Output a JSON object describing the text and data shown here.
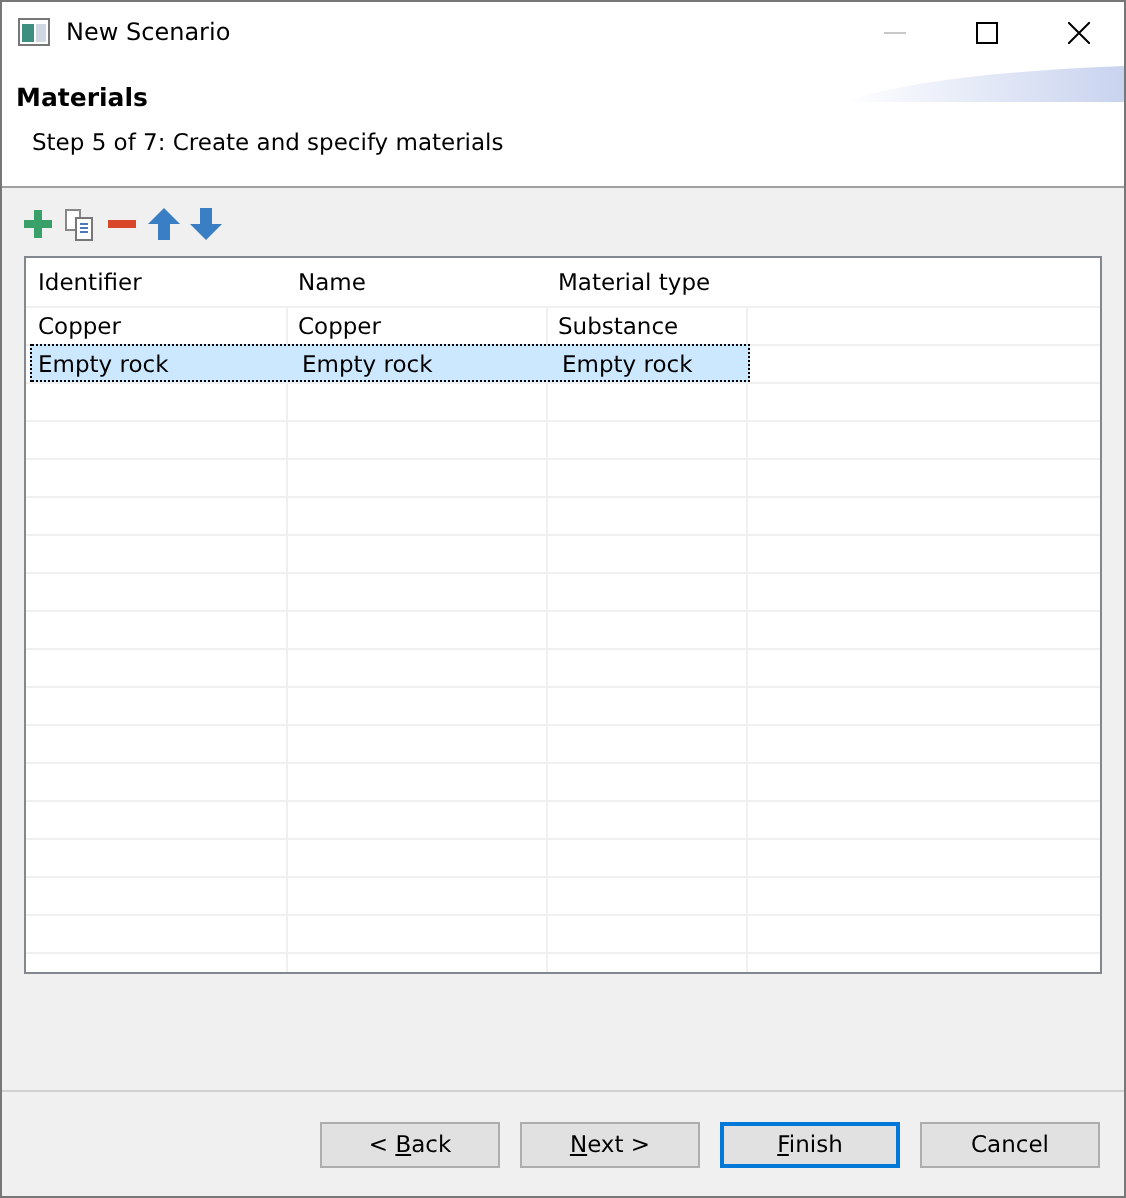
{
  "window": {
    "title": "New Scenario",
    "minimize_disabled": true
  },
  "header": {
    "title": "Materials",
    "subtitle": "Step 5 of 7: Create and specify materials"
  },
  "toolbar": [
    {
      "kind": "add"
    },
    {
      "kind": "copy"
    },
    {
      "kind": "remove"
    },
    {
      "kind": "up"
    },
    {
      "kind": "down"
    }
  ],
  "table": {
    "columns": [
      "Identifier",
      "Name",
      "Material type"
    ],
    "rows": [
      {
        "cells": [
          "Copper",
          "Copper",
          "Substance"
        ],
        "selected": false
      },
      {
        "cells": [
          "Empty rock",
          "Empty rock",
          "Empty rock"
        ],
        "selected": true
      }
    ]
  },
  "buttons": [
    {
      "before": "< ",
      "key": "B",
      "after": "ack",
      "default": false
    },
    {
      "key": "N",
      "after": "ext >",
      "default": false
    },
    {
      "key": "F",
      "after": "inish",
      "default": true
    },
    {
      "before": "Cancel",
      "default": false
    }
  ]
}
